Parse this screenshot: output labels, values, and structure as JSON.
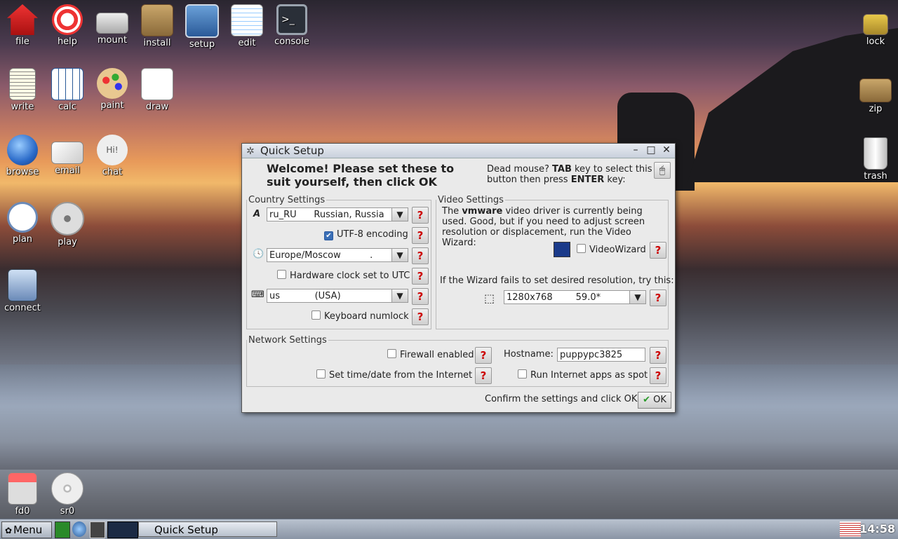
{
  "desktop": {
    "icons_left": [
      {
        "label": "file",
        "icon": "home-icon"
      },
      {
        "label": "help",
        "icon": "lifebuoy-icon"
      },
      {
        "label": "mount",
        "icon": "drive-icon"
      },
      {
        "label": "install",
        "icon": "box-icon"
      },
      {
        "label": "setup",
        "icon": "setup-icon"
      },
      {
        "label": "edit",
        "icon": "notepad-icon"
      },
      {
        "label": "console",
        "icon": "terminal-icon"
      },
      {
        "label": "write",
        "icon": "document-icon"
      },
      {
        "label": "calc",
        "icon": "spreadsheet-icon"
      },
      {
        "label": "paint",
        "icon": "palette-icon"
      },
      {
        "label": "draw",
        "icon": "draw-icon"
      },
      {
        "label": "browse",
        "icon": "globe-icon"
      },
      {
        "label": "email",
        "icon": "envelope-icon"
      },
      {
        "label": "chat",
        "icon": "chat-bubble-icon"
      },
      {
        "label": "plan",
        "icon": "clock-icon"
      },
      {
        "label": "play",
        "icon": "film-reel-icon"
      },
      {
        "label": "connect",
        "icon": "network-icon"
      },
      {
        "label": "fd0",
        "icon": "floppy-icon"
      },
      {
        "label": "sr0",
        "icon": "cd-icon"
      }
    ],
    "icons_right": [
      {
        "label": "lock",
        "icon": "padlock-icon"
      },
      {
        "label": "zip",
        "icon": "box-icon"
      },
      {
        "label": "trash",
        "icon": "trash-icon"
      }
    ],
    "chat_bubble_text": "Hi!"
  },
  "window": {
    "title": "Quick Setup",
    "welcome": "Welcome! Please set these to suit yourself, then click OK",
    "dead_mouse_pre": "Dead mouse? ",
    "dead_mouse_tab": "TAB",
    "dead_mouse_mid": " key to select this button then press ",
    "dead_mouse_enter": "ENTER",
    "dead_mouse_post": " key:",
    "country": {
      "legend": "Country Settings",
      "locale_value": "ru_RU      Russian, Russia",
      "utf8_label": "UTF-8 encoding",
      "timezone_value": "Europe/Moscow          .",
      "hwclock_label": "Hardware clock set to UTC",
      "keyboard_value": "us            (USA)",
      "numlock_label": "Keyboard numlock"
    },
    "video": {
      "legend": "Video Settings",
      "desc_pre": "The ",
      "driver": "vmware",
      "desc_post": " video driver is currently being used. Good, but if you need to adjust screen resolution or displacement, run the Video Wizard:",
      "wizard_label": "VideoWizard",
      "fallback_text": "If the Wizard fails to set desired resolution, try this:",
      "resolution_value": "1280x768        59.0*"
    },
    "network": {
      "legend": "Network Settings",
      "firewall_label": "Firewall enabled",
      "hostname_label": "Hostname:",
      "hostname_value": "puppypc3825",
      "timedate_label": "Set time/date from the Internet",
      "spot_label": "Run Internet apps as spot"
    },
    "confirm_text": "Confirm the settings and click OK:",
    "ok_label": "OK",
    "help_glyph": "?"
  },
  "taskbar": {
    "menu_label": "Menu",
    "task_label": "Quick Setup",
    "clock": "14:58"
  }
}
